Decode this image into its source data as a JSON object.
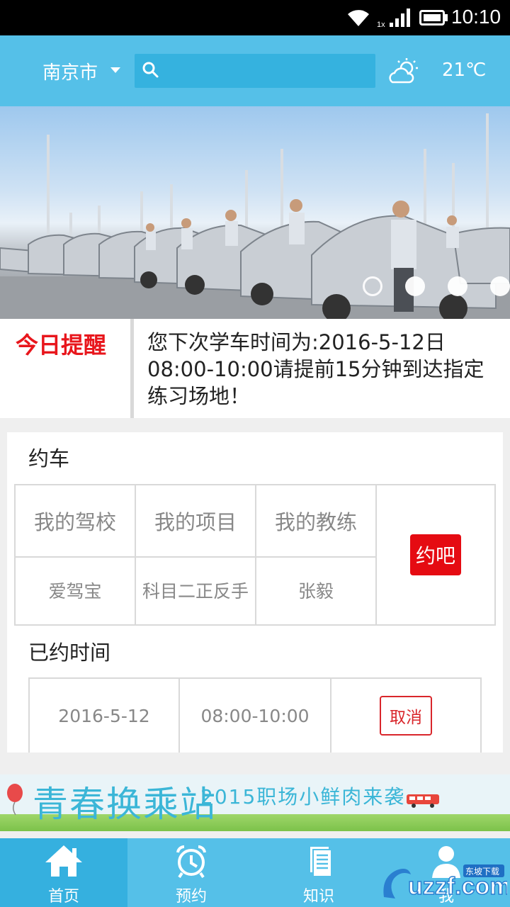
{
  "status_bar": {
    "network_label": "1x",
    "time": "10:10"
  },
  "header": {
    "city": "南京市",
    "search_placeholder": "",
    "temperature": "21℃",
    "weather_icon": "partly-cloudy-icon"
  },
  "banner": {
    "slide_count": 4,
    "active_slide": 1
  },
  "reminder": {
    "title": "今日提醒",
    "text": "您下次学车时间为:2016-5-12日08:00-10:00请提前15分钟到达指定练习场地！"
  },
  "booking": {
    "title": "约车",
    "headers": [
      "我的驾校",
      "我的项目",
      "我的教练"
    ],
    "values": [
      "爱驾宝",
      "科目二正反手",
      "张毅"
    ],
    "action_label": "约吧"
  },
  "booked": {
    "title": "已约时间",
    "date": "2016-5-12",
    "time": "08:00-10:00",
    "cancel_label": "取消"
  },
  "ad": {
    "title": "青春换乘站",
    "subtitle": "2015职场小鲜肉来袭"
  },
  "nav": {
    "items": [
      {
        "label": "首页",
        "icon": "home-icon"
      },
      {
        "label": "预约",
        "icon": "alarm-clock-icon"
      },
      {
        "label": "知识",
        "icon": "document-icon"
      },
      {
        "label": "我",
        "icon": "user-icon"
      }
    ]
  },
  "watermark": {
    "text": "uzzf.com",
    "badge": "东坡下载"
  },
  "colors": {
    "primary": "#55c0e8",
    "nav_active": "#35b0df",
    "accent_red": "#e50b12"
  }
}
